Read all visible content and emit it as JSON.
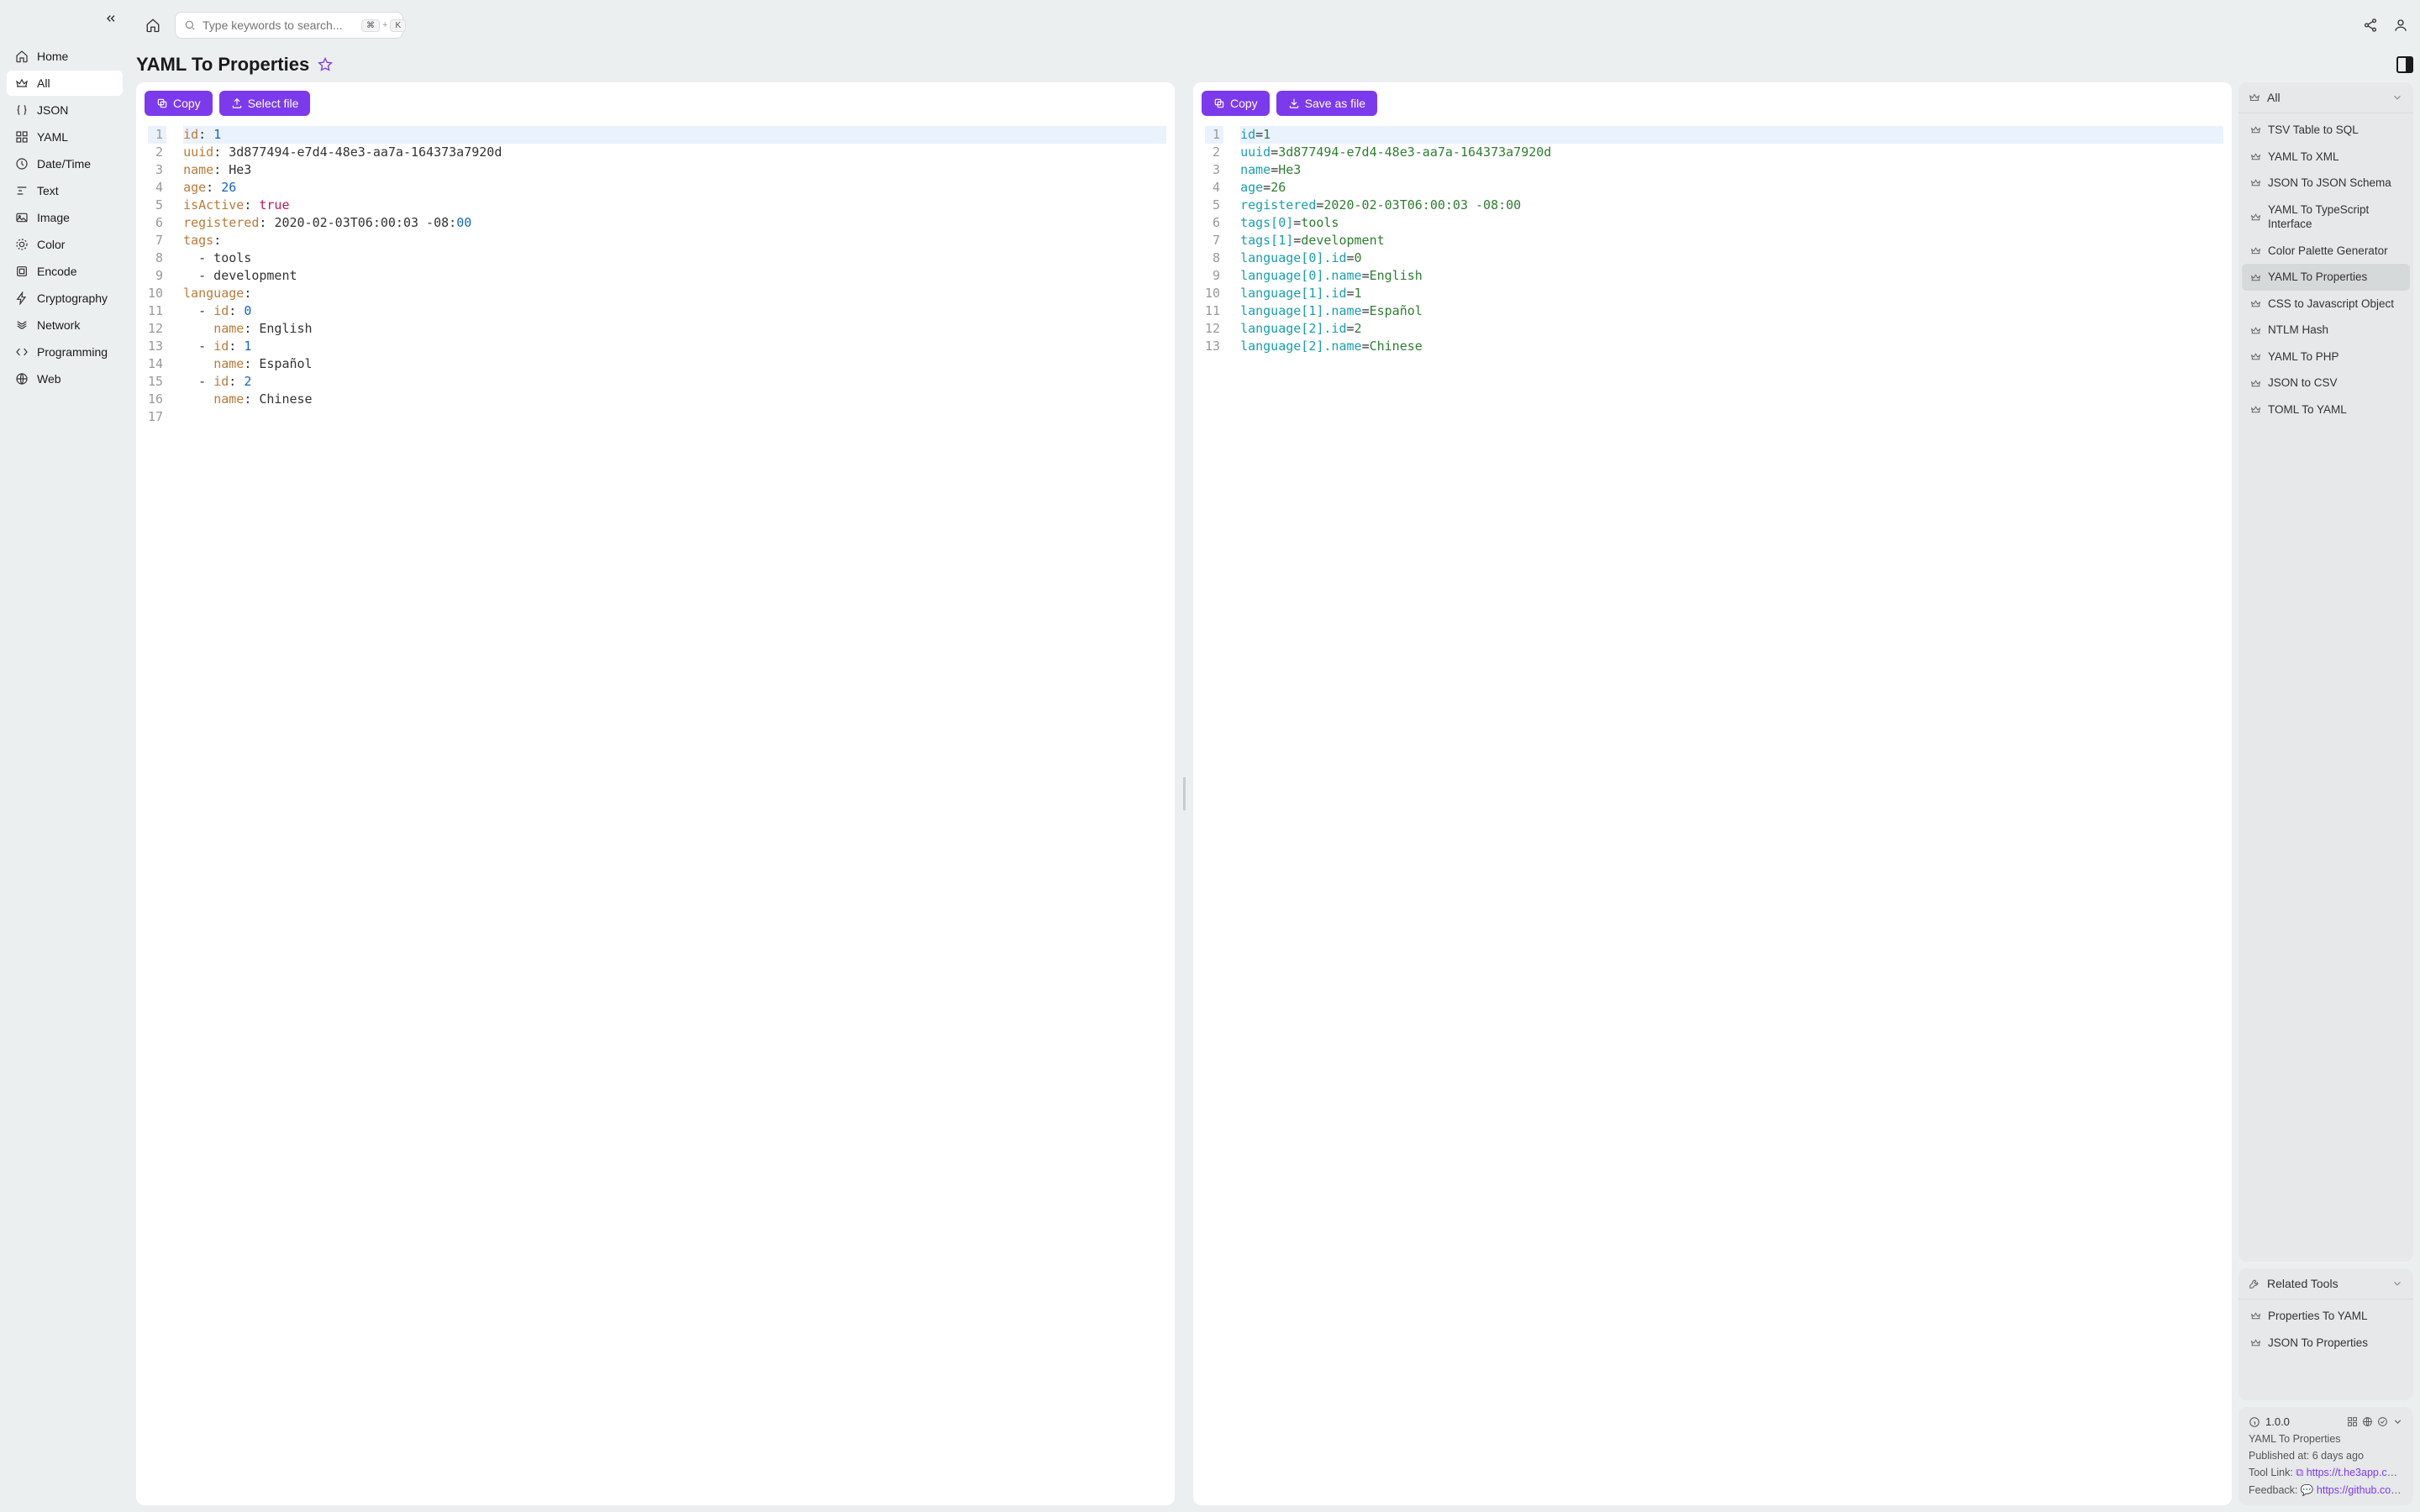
{
  "search": {
    "placeholder": "Type keywords to search..."
  },
  "sidebar": {
    "items": [
      {
        "label": "Home"
      },
      {
        "label": "All"
      },
      {
        "label": "JSON"
      },
      {
        "label": "YAML"
      },
      {
        "label": "Date/Time"
      },
      {
        "label": "Text"
      },
      {
        "label": "Image"
      },
      {
        "label": "Color"
      },
      {
        "label": "Encode"
      },
      {
        "label": "Cryptography"
      },
      {
        "label": "Network"
      },
      {
        "label": "Programming"
      },
      {
        "label": "Web"
      }
    ]
  },
  "page": {
    "title": "YAML To Properties"
  },
  "buttons": {
    "copy": "Copy",
    "select_file": "Select file",
    "save_file": "Save as file"
  },
  "left_editor": {
    "lines": [
      [
        [
          "key",
          "id"
        ],
        [
          "colon",
          ": "
        ],
        [
          "num",
          "1"
        ]
      ],
      [
        [
          "key",
          "uuid"
        ],
        [
          "colon",
          ": "
        ],
        [
          "str",
          "3d877494-e7d4-48e3-aa7a-164373a7920d"
        ]
      ],
      [
        [
          "key",
          "name"
        ],
        [
          "colon",
          ": "
        ],
        [
          "str",
          "He3"
        ]
      ],
      [
        [
          "key",
          "age"
        ],
        [
          "colon",
          ": "
        ],
        [
          "num",
          "26"
        ]
      ],
      [
        [
          "key",
          "isActive"
        ],
        [
          "colon",
          ": "
        ],
        [
          "bool",
          "true"
        ]
      ],
      [
        [
          "key",
          "registered"
        ],
        [
          "colon",
          ": "
        ],
        [
          "str",
          "2020-02-03T06:00:03 -08:"
        ],
        [
          "num",
          "00"
        ]
      ],
      [
        [
          "key",
          "tags"
        ],
        [
          "colon",
          ":"
        ]
      ],
      [
        [
          "str",
          "  - tools"
        ]
      ],
      [
        [
          "str",
          "  - development"
        ]
      ],
      [
        [
          "key",
          "language"
        ],
        [
          "colon",
          ":"
        ]
      ],
      [
        [
          "str",
          "  - "
        ],
        [
          "key",
          "id"
        ],
        [
          "colon",
          ": "
        ],
        [
          "num",
          "0"
        ]
      ],
      [
        [
          "str",
          "    "
        ],
        [
          "key",
          "name"
        ],
        [
          "colon",
          ": "
        ],
        [
          "str",
          "English"
        ]
      ],
      [
        [
          "str",
          "  - "
        ],
        [
          "key",
          "id"
        ],
        [
          "colon",
          ": "
        ],
        [
          "num",
          "1"
        ]
      ],
      [
        [
          "str",
          "    "
        ],
        [
          "key",
          "name"
        ],
        [
          "colon",
          ": "
        ],
        [
          "str",
          "Español"
        ]
      ],
      [
        [
          "str",
          "  - "
        ],
        [
          "key",
          "id"
        ],
        [
          "colon",
          ": "
        ],
        [
          "num",
          "2"
        ]
      ],
      [
        [
          "str",
          "    "
        ],
        [
          "key",
          "name"
        ],
        [
          "colon",
          ": "
        ],
        [
          "str",
          "Chinese"
        ]
      ],
      [
        [
          "str",
          ""
        ]
      ]
    ]
  },
  "right_editor": {
    "lines": [
      [
        [
          "prop",
          "id"
        ],
        [
          "eq",
          "="
        ],
        [
          "val",
          "1"
        ]
      ],
      [
        [
          "prop",
          "uuid"
        ],
        [
          "eq",
          "="
        ],
        [
          "val",
          "3d877494-e7d4-48e3-aa7a-164373a7920d"
        ]
      ],
      [
        [
          "prop",
          "name"
        ],
        [
          "eq",
          "="
        ],
        [
          "val",
          "He3"
        ]
      ],
      [
        [
          "prop",
          "age"
        ],
        [
          "eq",
          "="
        ],
        [
          "val",
          "26"
        ]
      ],
      [
        [
          "prop",
          "registered"
        ],
        [
          "eq",
          "="
        ],
        [
          "val",
          "2020-02-03T06:00:03 -08:00"
        ]
      ],
      [
        [
          "prop",
          "tags[0]"
        ],
        [
          "eq",
          "="
        ],
        [
          "val",
          "tools"
        ]
      ],
      [
        [
          "prop",
          "tags[1]"
        ],
        [
          "eq",
          "="
        ],
        [
          "val",
          "development"
        ]
      ],
      [
        [
          "prop",
          "language[0].id"
        ],
        [
          "eq",
          "="
        ],
        [
          "val",
          "0"
        ]
      ],
      [
        [
          "prop",
          "language[0].name"
        ],
        [
          "eq",
          "="
        ],
        [
          "val",
          "English"
        ]
      ],
      [
        [
          "prop",
          "language[1].id"
        ],
        [
          "eq",
          "="
        ],
        [
          "val",
          "1"
        ]
      ],
      [
        [
          "prop",
          "language[1].name"
        ],
        [
          "eq",
          "="
        ],
        [
          "val",
          "Español"
        ]
      ],
      [
        [
          "prop",
          "language[2].id"
        ],
        [
          "eq",
          "="
        ],
        [
          "val",
          "2"
        ]
      ],
      [
        [
          "prop",
          "language[2].name"
        ],
        [
          "eq",
          "="
        ],
        [
          "val",
          "Chinese"
        ]
      ]
    ]
  },
  "right_panel": {
    "all_header": "All",
    "tools": [
      "TSV Table to SQL",
      "YAML To XML",
      "JSON To JSON Schema",
      "YAML To TypeScript Interface",
      "Color Palette Generator",
      "YAML To Properties",
      "CSS to Javascript Object",
      "NTLM Hash",
      "YAML To PHP",
      "JSON to CSV",
      "TOML To YAML"
    ],
    "active_index": 5,
    "related_header": "Related Tools",
    "related": [
      "Properties To YAML",
      "JSON To Properties"
    ]
  },
  "info": {
    "version": "1.0.0",
    "name": "YAML To Properties",
    "published_label": "Published at: ",
    "published_value": "6 days ago",
    "tool_link_label": "Tool Link: ",
    "tool_link": "https://t.he3app.co…",
    "feedback_label": "Feedback: ",
    "feedback_link": "https://github.com/…"
  }
}
